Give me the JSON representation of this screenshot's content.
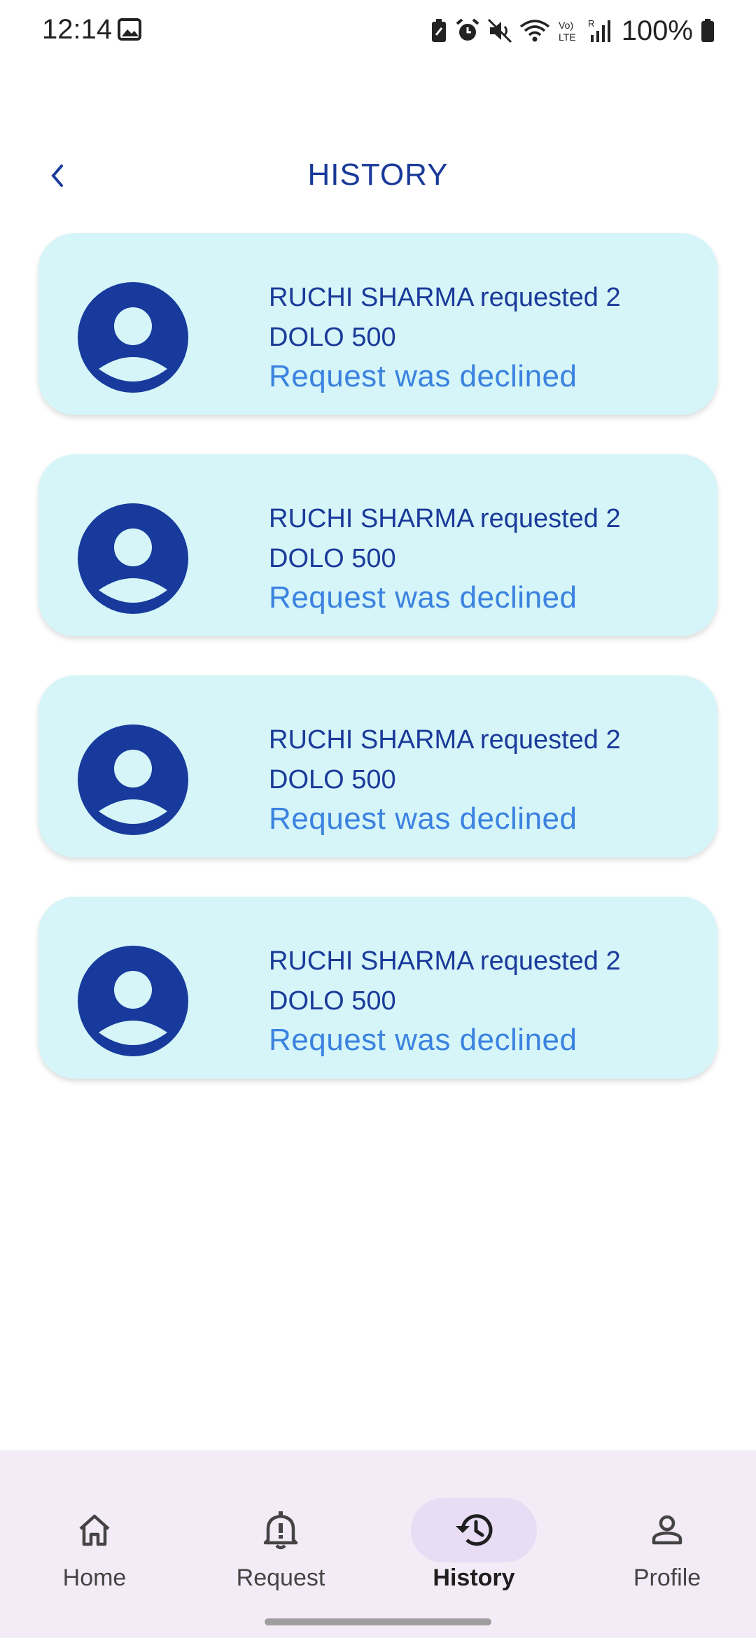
{
  "status_bar": {
    "time": "12:14",
    "battery": "100%",
    "icons": [
      "image-icon",
      "battery-saver-icon",
      "alarm-icon",
      "mute-icon",
      "wifi-icon",
      "volte-icon",
      "signal-icon",
      "battery-icon"
    ]
  },
  "header": {
    "title": "HISTORY",
    "back_icon": "chevron-left-icon"
  },
  "history": [
    {
      "line1": "RUCHI SHARMA requested 2",
      "line2": "DOLO 500",
      "status": "Request was declined"
    },
    {
      "line1": "RUCHI SHARMA requested 2",
      "line2": "DOLO 500",
      "status": "Request was declined"
    },
    {
      "line1": "RUCHI SHARMA requested 2",
      "line2": "DOLO 500",
      "status": "Request was declined"
    },
    {
      "line1": "RUCHI SHARMA requested 2",
      "line2": "DOLO 500",
      "status": "Request was declined"
    }
  ],
  "nav": {
    "items": [
      {
        "label": "Home",
        "icon": "home-icon"
      },
      {
        "label": "Request",
        "icon": "bell-alert-icon"
      },
      {
        "label": "History",
        "icon": "history-icon"
      },
      {
        "label": "Profile",
        "icon": "person-icon"
      }
    ],
    "active": "History"
  },
  "colors": {
    "title": "#1a3a9a",
    "card_bg": "#d5f5f8",
    "status_text": "#3b82e0",
    "avatar": "#173a9c",
    "nav_bg": "#f3ecf6",
    "nav_active_pill": "#e8ddf5"
  }
}
